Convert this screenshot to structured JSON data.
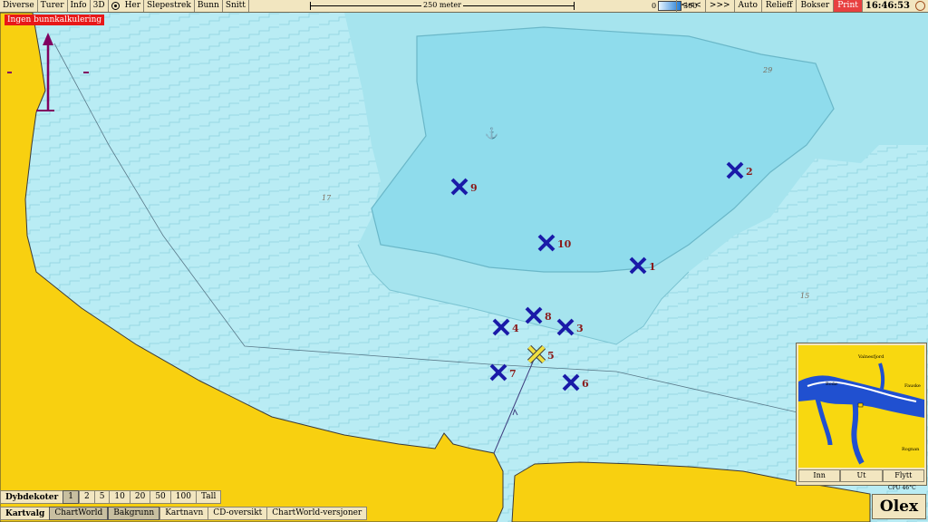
{
  "menu": {
    "items": [
      "Diverse",
      "Turer",
      "Info",
      "3D"
    ],
    "items2": [
      "Her",
      "Slepestrek",
      "Bunn",
      "Snitt"
    ]
  },
  "scale": {
    "label": "250 meter"
  },
  "depth_range": {
    "min": "0",
    "max": "300"
  },
  "right_menu": {
    "prev": "<<<",
    "next": ">>>",
    "auto": "Auto",
    "relieff": "Relieff",
    "bokser": "Bokser",
    "print": "Print"
  },
  "clock": "16:46:53",
  "warning": "Ingen bunnkalkulering",
  "waypoints": [
    {
      "label": "1"
    },
    {
      "label": "2"
    },
    {
      "label": "3"
    },
    {
      "label": "4"
    },
    {
      "label": "5"
    },
    {
      "label": "6"
    },
    {
      "label": "7"
    },
    {
      "label": "8"
    },
    {
      "label": "9"
    },
    {
      "label": "10"
    }
  ],
  "depth_labels": {
    "d1": "29",
    "d2": "17",
    "d3": "15"
  },
  "inset": {
    "places": {
      "p1": "Valnesfjord",
      "p2": "Fauske",
      "p3": "Bodø",
      "p4": "Rognan"
    },
    "buttons": {
      "inn": "Inn",
      "ut": "Ut",
      "flytt": "Flytt"
    }
  },
  "cpu": "CPU 46°C",
  "logo": "Olex",
  "dybdekoter": {
    "label": "Dybdekoter",
    "options": [
      "1",
      "2",
      "5",
      "10",
      "20",
      "50",
      "100",
      "Tall"
    ],
    "selected": "1"
  },
  "kartvalg": {
    "label": "Kartvalg",
    "options": [
      "ChartWorld",
      "Bakgrunn",
      "Kartnavn",
      "CD-oversikt",
      "ChartWorld-versjoner"
    ]
  },
  "colors": {
    "land": "#f8d010",
    "water_shallow": "#b9ecf4",
    "water_deep": "#8fdcec",
    "waypoint": "#1a1aa8",
    "selected_waypoint": "#f0e040"
  }
}
